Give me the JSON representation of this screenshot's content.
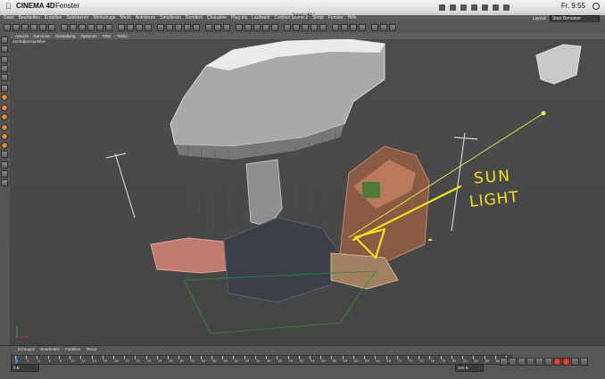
{
  "os_menubar": {
    "app_name": "CINEMA 4D",
    "menu": "Fenster",
    "clock": "Fr. 9:55"
  },
  "window": {
    "title": "Super.c4d *"
  },
  "app_menu": {
    "items": [
      "Datei",
      "Bearbeiten",
      "Erstellen",
      "Selektieren",
      "Werkzeuge",
      "Mesh",
      "Animieren",
      "Simulieren",
      "Rendern",
      "Charakter",
      "Plug-ins",
      "Laufwerk",
      "Cartoon Scene 2",
      "Skript",
      "Fenster",
      "Hilfe"
    ],
    "layout_label": "Layout:",
    "layout_value": "Start Benutzer"
  },
  "viewport": {
    "menu": [
      "Ansicht",
      "Kameras",
      "Darstellung",
      "Optionen",
      "Filter",
      "Tafeln"
    ],
    "title": "Zentralperspektive",
    "annotation_line1": "SUN",
    "annotation_line2": "LIGHT"
  },
  "timeline": {
    "tabs": [
      "Erzeugen",
      "Bearbeiten",
      "Funktion",
      "Textur"
    ],
    "ticks": [
      "0",
      "2",
      "4",
      "6",
      "8",
      "10",
      "12",
      "14",
      "16",
      "18",
      "20",
      "22",
      "24",
      "26",
      "28",
      "30",
      "32",
      "34",
      "36",
      "38",
      "40",
      "42",
      "44",
      "46",
      "48",
      "50",
      "52",
      "54",
      "56",
      "58",
      "60",
      "62",
      "64",
      "66",
      "68",
      "70",
      "72",
      "74",
      "76",
      "78",
      "80",
      "82",
      "84",
      "86",
      "88",
      "90"
    ],
    "start_frame": "0 B",
    "end_frame": "100 B"
  },
  "colors": {
    "annotation": "#f2e11a",
    "playhead": "#2e7bd2",
    "record": "#e83a2a"
  }
}
